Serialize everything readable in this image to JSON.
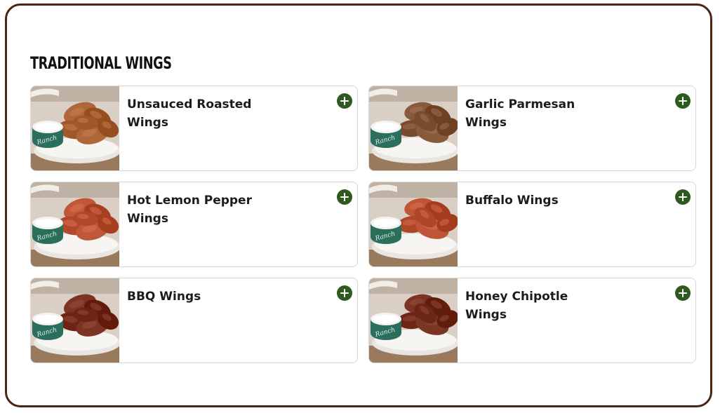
{
  "section": {
    "title": "TRADITIONAL WINGS"
  },
  "items": [
    {
      "name": "Unsauced Roasted Wings",
      "sauce_color": "#a0582a",
      "dip_label": "Ranch"
    },
    {
      "name": "Garlic Parmesan Wings",
      "sauce_color": "#7a4a2c",
      "dip_label": "Ranch"
    },
    {
      "name": "Hot Lemon Pepper Wings",
      "sauce_color": "#b2482a",
      "dip_label": "Ranch"
    },
    {
      "name": "Buffalo Wings",
      "sauce_color": "#b04628",
      "dip_label": "Ranch"
    },
    {
      "name": "BBQ Wings",
      "sauce_color": "#6e2414",
      "dip_label": "Ranch"
    },
    {
      "name": "Honey Chipotle Wings",
      "sauce_color": "#6c2616",
      "dip_label": "Ranch"
    }
  ],
  "colors": {
    "frame_border": "#4a250f",
    "add_button": "#2f5a1f",
    "ranch_cup": "#2c6e5c"
  },
  "icons": {
    "add": "plus-circle-icon"
  }
}
